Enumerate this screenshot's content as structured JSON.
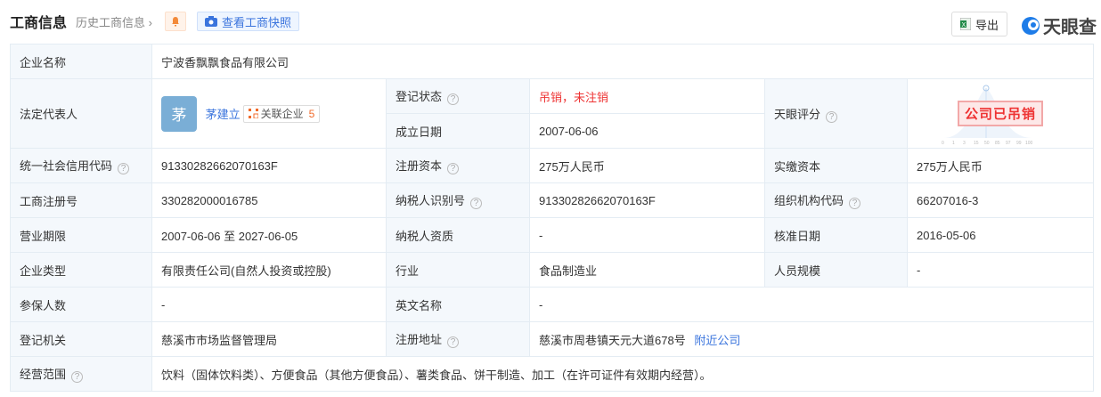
{
  "header": {
    "title": "工商信息",
    "history": "历史工商信息",
    "snapshot": "查看工商快照",
    "export": "导出",
    "logo": "天眼查"
  },
  "rows": {
    "name_label": "企业名称",
    "name": "宁波香飘飘食品有限公司",
    "legal_label": "法定代表人",
    "legal_avatar": "茅",
    "legal_name": "茅建立",
    "related_label": "关联企业",
    "related_count": "5",
    "status_label": "登记状态",
    "status": "吊销，未注销",
    "est_label": "成立日期",
    "est": "2007-06-06",
    "score_label": "天眼评分",
    "score_stamp": "公司已吊销",
    "score_ticks": [
      "0",
      "1",
      "3",
      "15",
      "50",
      "85",
      "97",
      "99",
      "100"
    ],
    "credit_label": "统一社会信用代码",
    "credit": "91330282662070163F",
    "capital_label": "注册资本",
    "capital": "275万人民币",
    "paid_label": "实缴资本",
    "paid": "275万人民币",
    "regno_label": "工商注册号",
    "regno": "330282000016785",
    "taxid_label": "纳税人识别号",
    "taxid": "91330282662070163F",
    "org_label": "组织机构代码",
    "org": "66207016-3",
    "term_label": "营业期限",
    "term": "2007-06-06 至 2027-06-05",
    "taxq_label": "纳税人资质",
    "taxq": "-",
    "approve_label": "核准日期",
    "approve": "2016-05-06",
    "type_label": "企业类型",
    "type": "有限责任公司(自然人投资或控股)",
    "industry_label": "行业",
    "industry": "食品制造业",
    "staff_label": "人员规模",
    "staff": "-",
    "insured_label": "参保人数",
    "insured": "-",
    "en_label": "英文名称",
    "en": "-",
    "authority_label": "登记机关",
    "authority": "慈溪市市场监督管理局",
    "addr_label": "注册地址",
    "addr": "慈溪市周巷镇天元大道678号",
    "nearby": "附近公司",
    "scope_label": "经营范围",
    "scope": "饮料（固体饮料类）、方便食品（其他方便食品）、薯类食品、饼干制造、加工（在许可证件有效期内经营）。"
  }
}
